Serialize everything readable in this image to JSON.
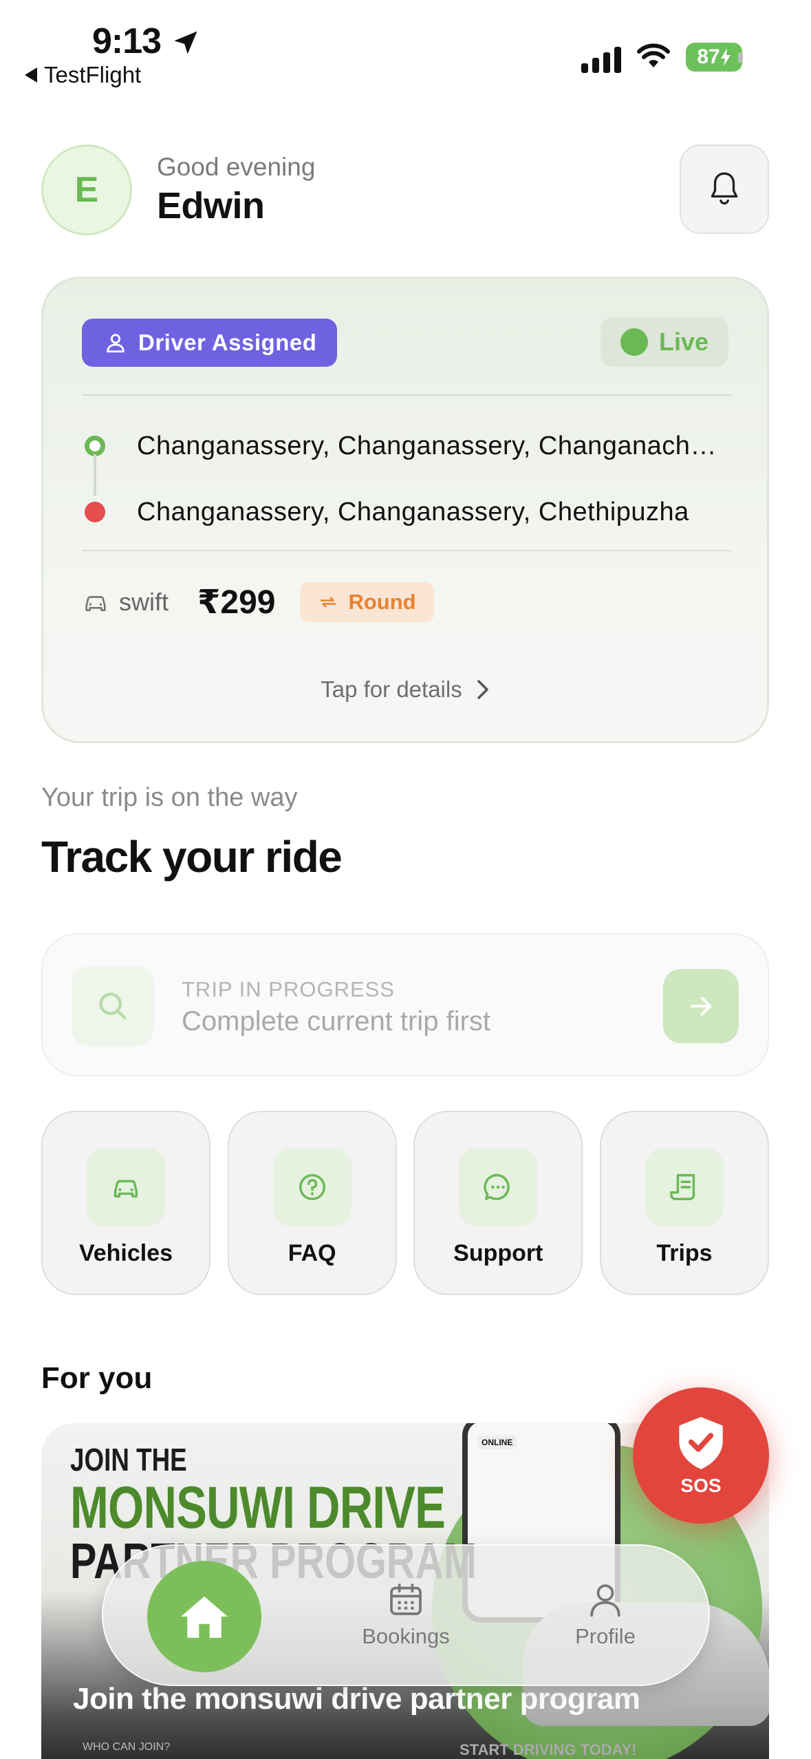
{
  "status_bar": {
    "time": "9:13",
    "back_app": "TestFlight",
    "battery": "87"
  },
  "header": {
    "avatar_initial": "E",
    "greeting": "Good evening",
    "name": "Edwin"
  },
  "trip_card": {
    "status_badge": "Driver Assigned",
    "live_label": "Live",
    "pickup": "Changanassery, Changanassery, Changanacherry",
    "drop": "Changanassery, Changanassery, Chethipuzha",
    "vehicle": "swift",
    "fare": "₹299",
    "trip_type": "Round",
    "details_link": "Tap for details"
  },
  "section": {
    "subtitle": "Your trip is on the way",
    "title": "Track your ride"
  },
  "trip_bar": {
    "small_label": "TRIP IN PROGRESS",
    "main_label": "Complete current trip first"
  },
  "actions": [
    {
      "label": "Vehicles",
      "icon": "car-icon"
    },
    {
      "label": "FAQ",
      "icon": "question-icon"
    },
    {
      "label": "Support",
      "icon": "chat-icon"
    },
    {
      "label": "Trips",
      "icon": "receipt-icon"
    }
  ],
  "for_you": {
    "heading": "For you",
    "promo": {
      "line1": "JOIN THE",
      "line2": "MONSUWI DRIVE",
      "line3": "PARTNER PROGRAM",
      "phone_status": "ONLINE",
      "caption": "Join the monsuwi drive partner program",
      "footer_left": "WHO CAN JOIN?",
      "footer_right": "START DRIVING TODAY!"
    }
  },
  "sos": {
    "label": "SOS"
  },
  "bottom_nav": {
    "home": "Home",
    "bookings": "Bookings",
    "profile": "Profile"
  },
  "colors": {
    "accent_green": "#6bb955",
    "driver_badge": "#6e62e0",
    "sos_red": "#e2453c",
    "round_orange": "#e8822e"
  }
}
